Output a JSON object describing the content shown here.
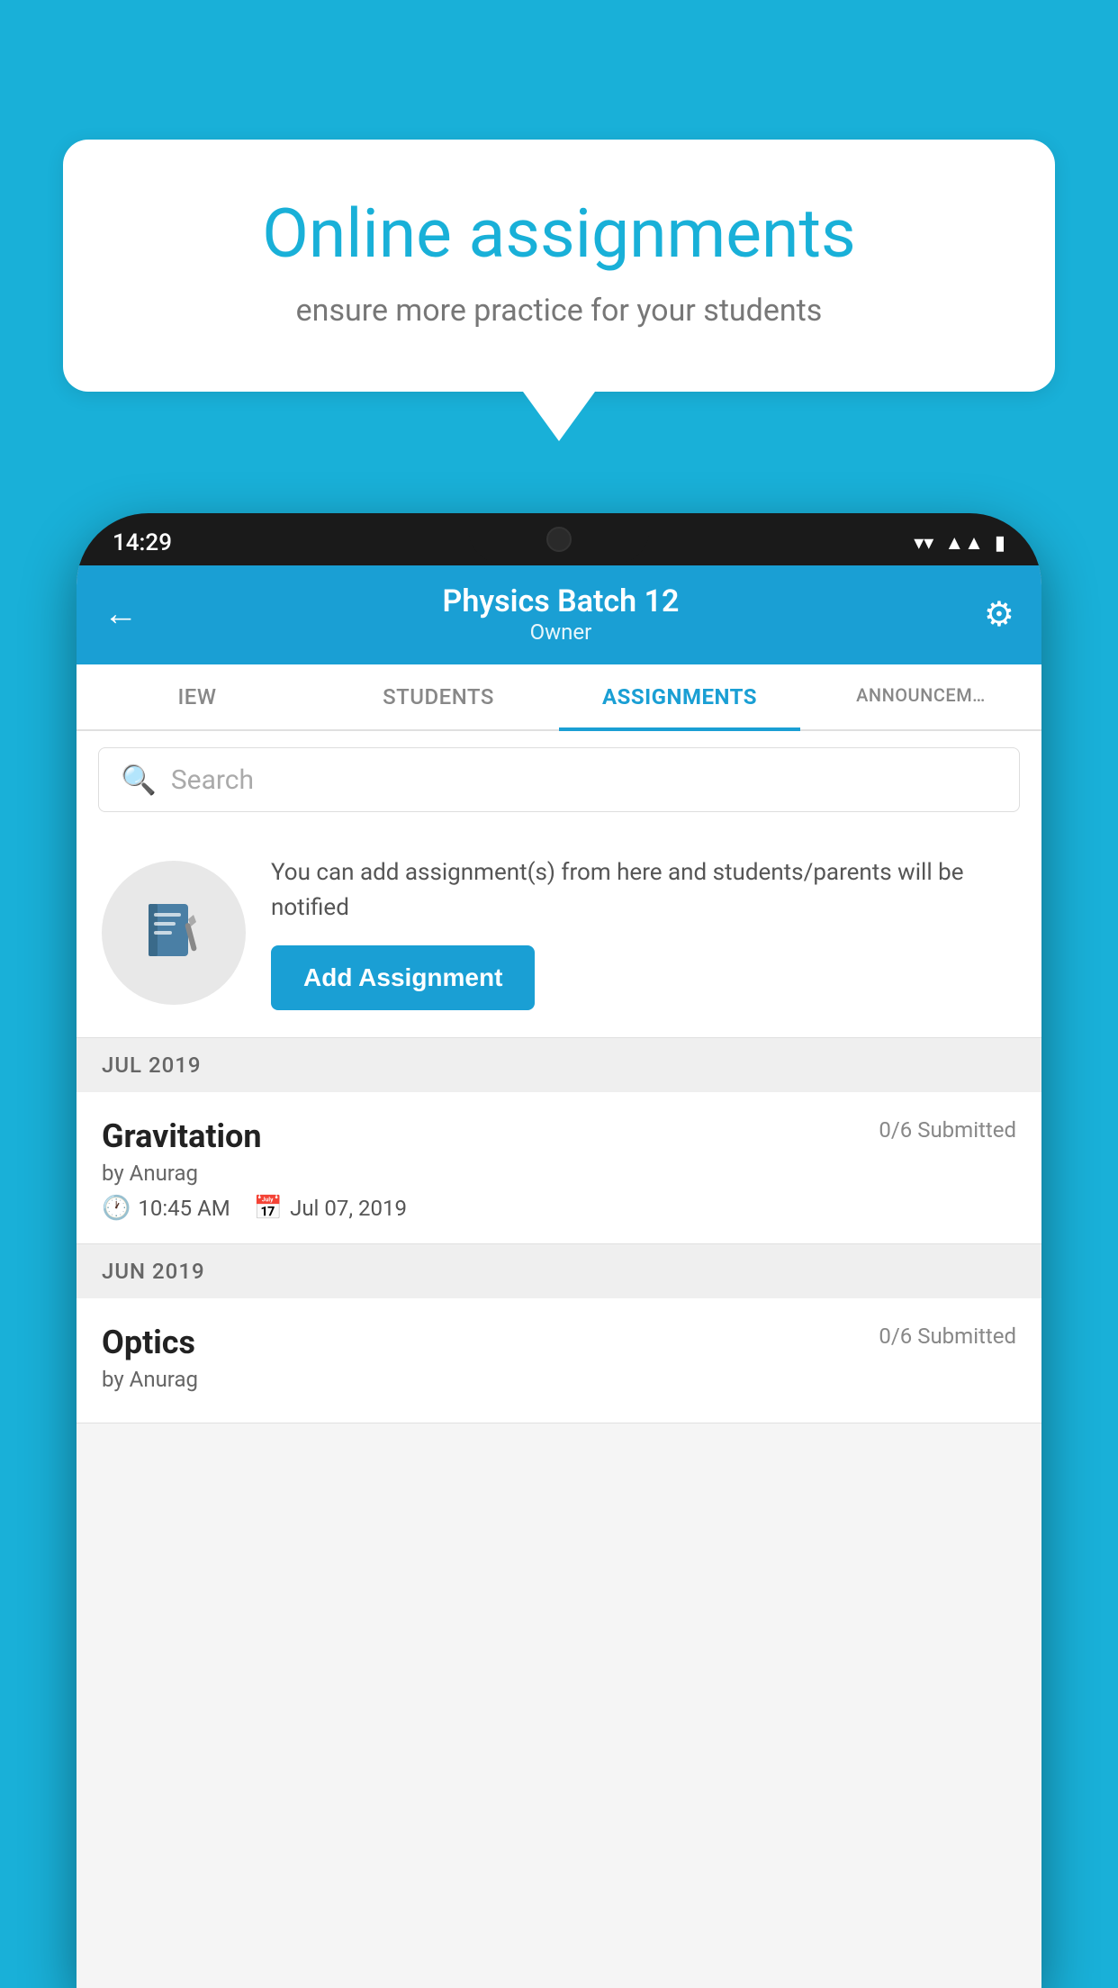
{
  "background_color": "#19b0d8",
  "speech_bubble": {
    "title": "Online assignments",
    "subtitle": "ensure more practice for your students"
  },
  "phone": {
    "status_bar": {
      "time": "14:29",
      "icons": [
        "wifi",
        "signal",
        "battery"
      ]
    },
    "header": {
      "title": "Physics Batch 12",
      "subtitle": "Owner",
      "back_label": "←",
      "settings_label": "⚙"
    },
    "tabs": [
      {
        "label": "IEW",
        "active": false
      },
      {
        "label": "STUDENTS",
        "active": false
      },
      {
        "label": "ASSIGNMENTS",
        "active": true
      },
      {
        "label": "ANNOUNCEM…",
        "active": false
      }
    ],
    "search": {
      "placeholder": "Search"
    },
    "promo": {
      "text": "You can add assignment(s) from here and students/parents will be notified",
      "button_label": "Add Assignment"
    },
    "sections": [
      {
        "month": "JUL 2019",
        "assignments": [
          {
            "name": "Gravitation",
            "submitted": "0/6 Submitted",
            "by": "by Anurag",
            "time": "10:45 AM",
            "date": "Jul 07, 2019"
          }
        ]
      },
      {
        "month": "JUN 2019",
        "assignments": [
          {
            "name": "Optics",
            "submitted": "0/6 Submitted",
            "by": "by Anurag",
            "time": "",
            "date": ""
          }
        ]
      }
    ]
  }
}
